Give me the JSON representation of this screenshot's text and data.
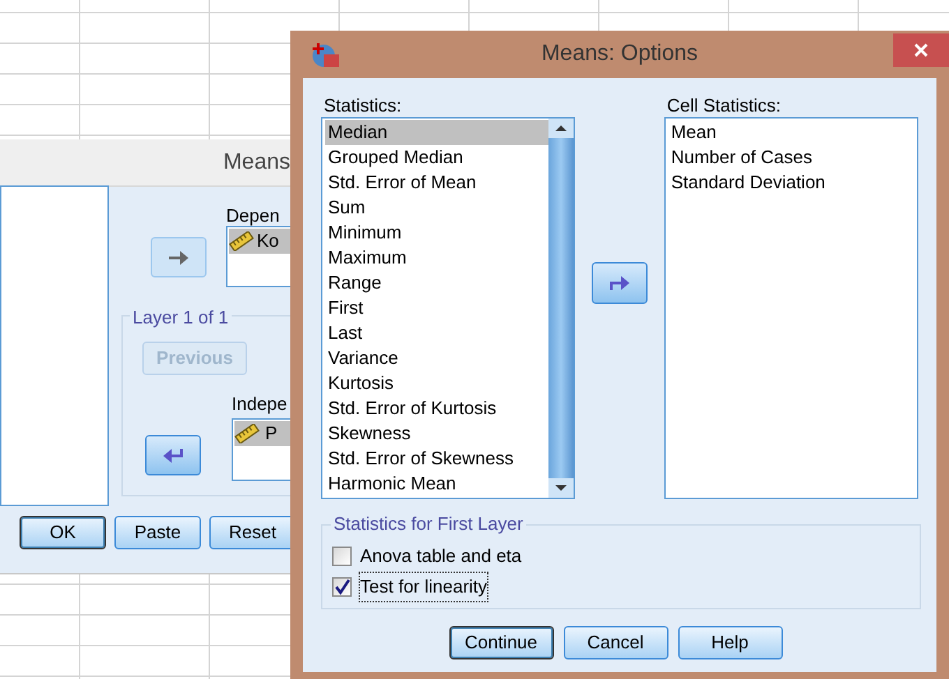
{
  "back_dialog": {
    "title": "Means",
    "dependent_label": "Depen",
    "dependent_items": [
      "Ko"
    ],
    "layer_label": "Layer 1 of 1",
    "previous_button": {
      "label": "Previous",
      "disabled": true
    },
    "independent_label": "Indepe",
    "independent_items": [
      "P"
    ],
    "buttons": [
      {
        "label": "OK",
        "default": true
      },
      {
        "label": "Paste",
        "default": false
      },
      {
        "label": "Reset",
        "default": false
      }
    ]
  },
  "dialog": {
    "title": "Means: Options",
    "statistics_label": "Statistics:",
    "statistics": [
      {
        "label": "Median",
        "selected": true
      },
      {
        "label": "Grouped Median",
        "selected": false
      },
      {
        "label": "Std. Error of Mean",
        "selected": false
      },
      {
        "label": "Sum",
        "selected": false
      },
      {
        "label": "Minimum",
        "selected": false
      },
      {
        "label": "Maximum",
        "selected": false
      },
      {
        "label": "Range",
        "selected": false
      },
      {
        "label": "First",
        "selected": false
      },
      {
        "label": "Last",
        "selected": false
      },
      {
        "label": "Variance",
        "selected": false
      },
      {
        "label": "Kurtosis",
        "selected": false
      },
      {
        "label": "Std. Error of Kurtosis",
        "selected": false
      },
      {
        "label": "Skewness",
        "selected": false
      },
      {
        "label": "Std. Error of Skewness",
        "selected": false
      },
      {
        "label": "Harmonic Mean",
        "selected": false
      }
    ],
    "cell_statistics_label": "Cell Statistics:",
    "cell_statistics": [
      "Mean",
      "Number of Cases",
      "Standard Deviation"
    ],
    "first_layer": {
      "title": "Statistics for First Layer",
      "options": [
        {
          "label": "Anova table and eta",
          "checked": false
        },
        {
          "label": "Test for linearity",
          "checked": true
        }
      ]
    },
    "buttons": [
      {
        "label": "Continue",
        "default": true
      },
      {
        "label": "Cancel",
        "default": false
      },
      {
        "label": "Help",
        "default": false
      }
    ]
  }
}
